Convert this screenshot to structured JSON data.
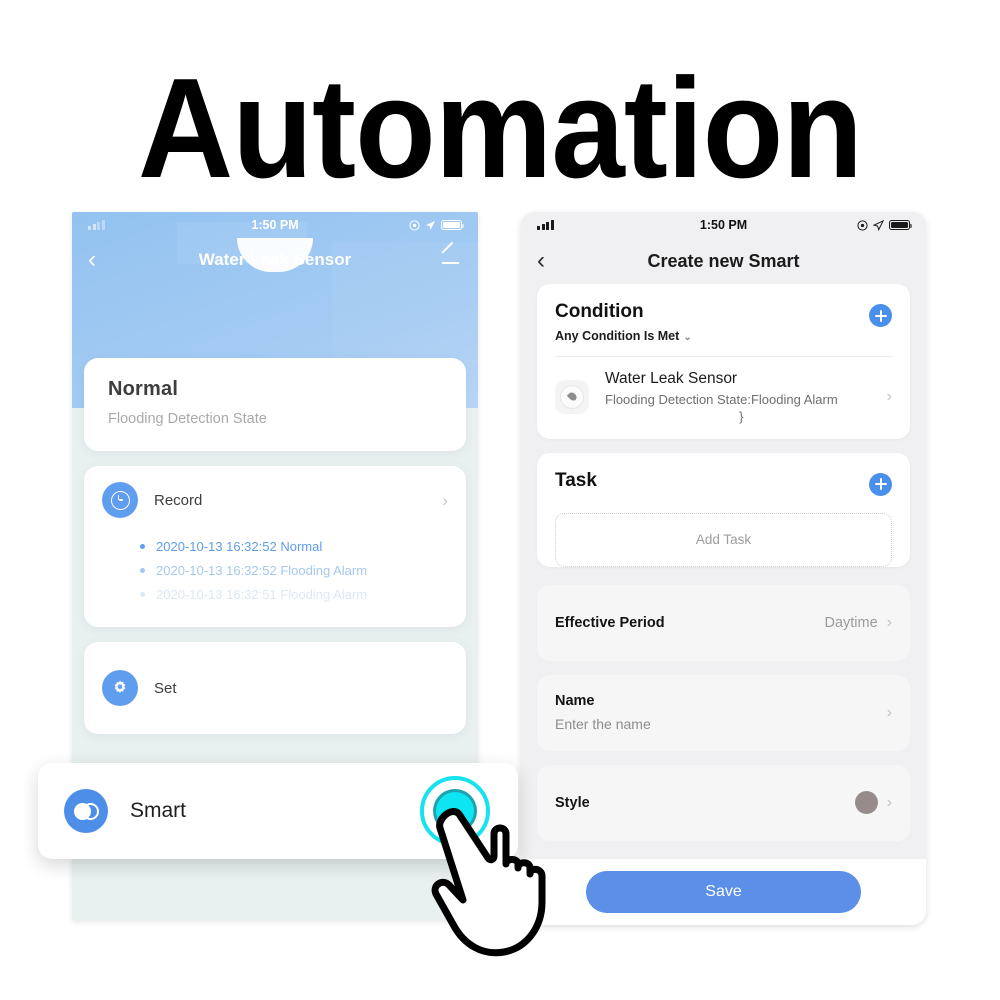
{
  "page": {
    "title": "Automation"
  },
  "left_phone": {
    "status_bar": {
      "time": "1:50 PM",
      "signal_icon": "signal-bars-icon",
      "record_icon": "record-indicator-icon",
      "location_icon": "location-arrow-icon",
      "battery_icon": "battery-icon"
    },
    "nav": {
      "back_icon": "chevron-left-icon",
      "title": "Water Leak Sensor",
      "edit_icon": "pencil-edit-icon"
    },
    "status_card": {
      "state": "Normal",
      "description": "Flooding Detection State"
    },
    "record_card": {
      "icon": "clock-icon",
      "label": "Record",
      "chevron": "›",
      "entries": [
        "2020-10-13 16:32:52 Normal",
        "2020-10-13 16:32:52 Flooding Alarm",
        "2020-10-13 16:32:51 Flooding Alarm"
      ]
    },
    "set_card": {
      "icon": "gear-icon",
      "label": "Set"
    },
    "smart_popup": {
      "icon": "smart-automation-icon",
      "label": "Smart"
    },
    "colors": {
      "header_gradient_start": "#93c2f0",
      "header_gradient_end": "#b3d3f5",
      "accent": "#5f9def",
      "body_bg": "#e9f0f0"
    }
  },
  "right_phone": {
    "status_bar": {
      "time": "1:50 PM",
      "signal_icon": "signal-bars-icon",
      "record_icon": "record-indicator-icon",
      "location_icon": "location-arrow-icon",
      "battery_icon": "battery-icon"
    },
    "nav": {
      "back_icon": "chevron-left-icon",
      "title": "Create new Smart"
    },
    "condition_card": {
      "title": "Condition",
      "subtitle": "Any Condition Is Met",
      "caret": "⌄",
      "add_icon": "plus-circle-icon",
      "item": {
        "icon": "water-leak-sensor-icon",
        "name": "Water Leak Sensor",
        "detail": "Flooding Detection State:Flooding Alarm",
        "detail_overflow": "}",
        "chevron": "›"
      }
    },
    "task_card": {
      "title": "Task",
      "add_icon": "plus-circle-icon",
      "add_placeholder": "Add Task"
    },
    "effective_period": {
      "label": "Effective Period",
      "value": "Daytime",
      "chevron": "›"
    },
    "name_row": {
      "label": "Name",
      "placeholder": "Enter the name",
      "chevron": "›"
    },
    "style_row": {
      "label": "Style",
      "swatch_color": "#978b8b",
      "chevron": "›"
    },
    "save_button": {
      "label": "Save",
      "color": "#5b8fe8"
    },
    "colors": {
      "body_bg": "#f0f0f2",
      "accent": "#4a90ea"
    }
  },
  "cursor": {
    "type": "hand-pointer-icon",
    "ring_color": "#17e3f0",
    "target": "smart-popup-tap-target"
  }
}
